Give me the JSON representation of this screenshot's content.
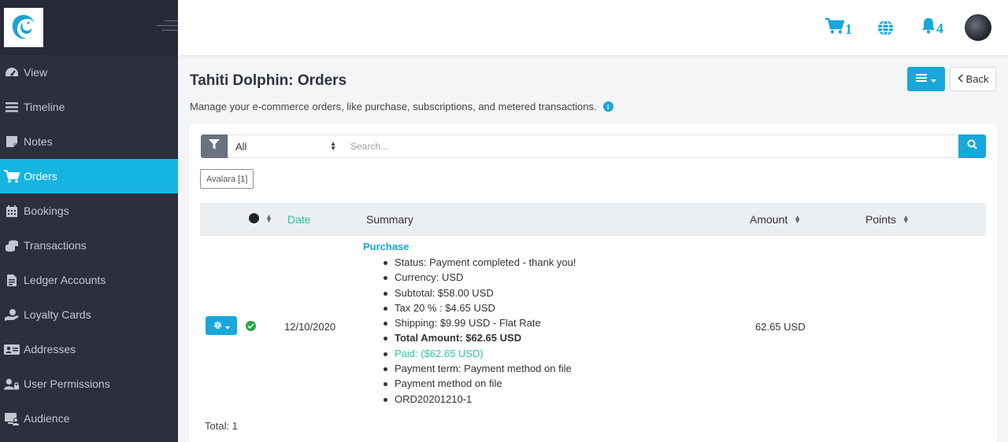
{
  "sidebar": {
    "logo_icon": "dolphin-logo-icon",
    "items": [
      {
        "label": "View",
        "icon": "dashboard-icon",
        "active": false
      },
      {
        "label": "Timeline",
        "icon": "timeline-icon",
        "active": false
      },
      {
        "label": "Notes",
        "icon": "note-icon",
        "active": false
      },
      {
        "label": "Orders",
        "icon": "cart-icon",
        "active": true
      },
      {
        "label": "Bookings",
        "icon": "calendar-icon",
        "active": false
      },
      {
        "label": "Transactions",
        "icon": "coins-icon",
        "active": false
      },
      {
        "label": "Ledger Accounts",
        "icon": "ledger-icon",
        "active": false
      },
      {
        "label": "Loyalty Cards",
        "icon": "hand-holding-icon",
        "active": false
      },
      {
        "label": "Addresses",
        "icon": "address-card-icon",
        "active": false
      },
      {
        "label": "User Permissions",
        "icon": "user-lock-icon",
        "active": false
      },
      {
        "label": "Audience",
        "icon": "audience-icon",
        "active": false
      }
    ]
  },
  "topbar": {
    "cart_count": "1",
    "notification_count": "4"
  },
  "page": {
    "title": "Tahiti Dolphin: Orders",
    "description": "Manage your e-commerce orders, like purchase, subscriptions, and metered transactions.",
    "back_label": "Back"
  },
  "filters": {
    "select_value": "All",
    "search_placeholder": "Search...",
    "tag_label": "Avalara [1]"
  },
  "table": {
    "headers": {
      "date": "Date",
      "summary": "Summary",
      "amount": "Amount",
      "points": "Points"
    },
    "rows": [
      {
        "date": "12/10/2020",
        "summary_title": "Purchase",
        "summary_lines": [
          "Status: Payment completed - thank you!",
          "Currency: USD",
          "Subtotal: $58.00 USD",
          "Tax 20 % : $4.65 USD",
          "Shipping: $9.99 USD - Flat Rate",
          "Total Amount: $62.65 USD",
          "Paid: ($62.65 USD)",
          "Payment term: Payment method on file",
          "Payment method on file",
          "ORD20201210-1"
        ],
        "amount": "62.65 USD",
        "points": ""
      }
    ],
    "total_label": "Total: 1"
  },
  "colors": {
    "accent": "#17a7db",
    "sidebar_bg": "#2c2f3d",
    "success": "#28a745",
    "paid": "#2bc3a2"
  }
}
